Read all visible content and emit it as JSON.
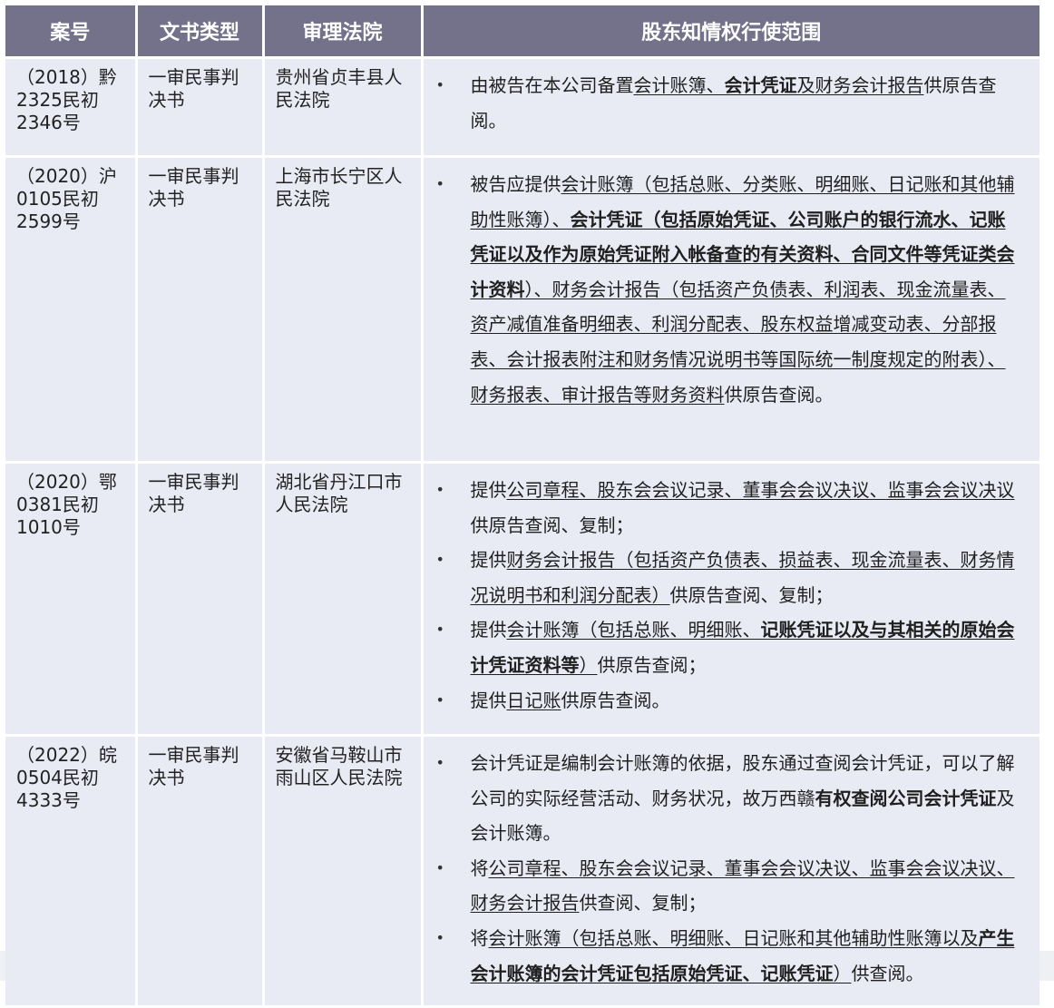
{
  "table": {
    "headers": [
      "案号",
      "文书类型",
      "审理法院",
      "股东知情权行使范围"
    ],
    "rows": [
      {
        "case_no": "（2018）黔2325民初2346号",
        "doc_type": "一审民事判决书",
        "court": "贵州省贞丰县人民法院",
        "scope": [
          [
            {
              "t": "由被告在本公司备置"
            },
            {
              "t": "会计账簿、",
              "u": true
            },
            {
              "t": "会计凭证",
              "u": true,
              "b": true
            },
            {
              "t": "及",
              "u": true
            },
            {
              "t": "财务会计报告",
              "u": true
            },
            {
              "t": "供原告查阅。"
            }
          ]
        ]
      },
      {
        "case_no": "（2020）沪0105民初2599号",
        "doc_type": "一审民事判决书",
        "court": "上海市长宁区人民法院",
        "scope": [
          [
            {
              "t": "被告应提供"
            },
            {
              "t": "会计账簿（包括总账、分类账、明细账、日记账和其他辅助性账簿）、",
              "u": true
            },
            {
              "t": "会计凭证（包括原始凭证、公司账户的银行流水、记账凭证以及作为原始凭证附入帐备查的有关资料、合同文件等凭证类会计资料",
              "u": true,
              "b": true
            },
            {
              "t": "）、财务会计报告（包括资产负债表、利润表、现金流量表、资产减值准备明细表、利润分配表、股东权益增减变动表、分部报表、会计报表附注和财务情况说明书等国际统一制度规定的附表）、财务报表、审计报告等财务资料",
              "u": true
            },
            {
              "t": "供原告查阅。"
            }
          ]
        ]
      },
      {
        "case_no": "（2020）鄂0381民初1010号",
        "doc_type": "一审民事判决书",
        "court": "湖北省丹江口市人民法院",
        "scope": [
          [
            {
              "t": "提供"
            },
            {
              "t": "公司章程、股东会会议记录、董事会会议决议、监事会会议决议",
              "u": true
            },
            {
              "t": "供原告查阅、复制；"
            }
          ],
          [
            {
              "t": "提供"
            },
            {
              "t": "财务会计报告（包括资产负债表、损益表、现金流量表、财务情况说明书和利润分配表）",
              "u": true
            },
            {
              "t": "供原告查阅、复制；"
            }
          ],
          [
            {
              "t": "提供"
            },
            {
              "t": "会计账簿（包括总账、明细账、",
              "u": true
            },
            {
              "t": "记账凭证以及与其相关的原始会计凭证资料等",
              "u": true,
              "b": true
            },
            {
              "t": "）",
              "u": true
            },
            {
              "t": "供原告查阅；"
            }
          ],
          [
            {
              "t": "提供"
            },
            {
              "t": "日记账",
              "u": true
            },
            {
              "t": "供原告查阅。"
            }
          ]
        ]
      },
      {
        "case_no": "（2022）皖0504民初4333号",
        "doc_type": "一审民事判决书",
        "court": "安徽省马鞍山市雨山区人民法院",
        "scope": [
          [
            {
              "t": "会计凭证是编制会计账簿的依据，股东通过查阅会计凭证，可以了解公司的实际经营活动、财务状况，故万西赣"
            },
            {
              "t": "有权查阅公司会计凭证",
              "b": true
            },
            {
              "t": "及会计账簿。"
            }
          ],
          [
            {
              "t": "将"
            },
            {
              "t": "公司章程、股东会会议记录、董事会会议决议、监事会会议决议、财务会计报告",
              "u": true
            },
            {
              "t": "供查阅、复制；"
            }
          ],
          [
            {
              "t": "将"
            },
            {
              "t": "会计账簿（包括总账、明细账、日记账和其他辅助性账簿以及",
              "u": true
            },
            {
              "t": "产生会计账簿的会计凭证包括原始凭证、记账凭证",
              "u": true,
              "b": true
            },
            {
              "t": "）",
              "u": true
            },
            {
              "t": "供查阅。"
            }
          ]
        ]
      }
    ]
  }
}
